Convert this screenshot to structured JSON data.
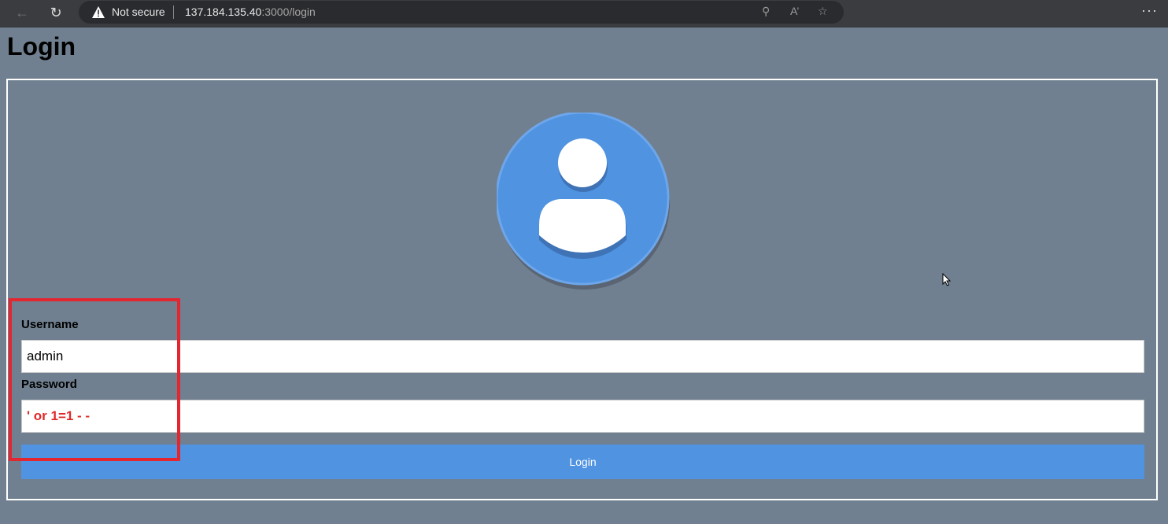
{
  "browser": {
    "security_label": "Not secure",
    "url_host": "137.184.135.40",
    "url_rest": ":3000/login",
    "menu_label": "···"
  },
  "page": {
    "title": "Login"
  },
  "form": {
    "username_label": "Username",
    "username_value": "admin",
    "password_label": "Password",
    "password_value": "' or 1=1 - -",
    "submit_label": "Login"
  },
  "colors": {
    "page_background": "#708090",
    "button": "#4f93e1",
    "avatar": "#4f93e1",
    "highlight": "#e3262f",
    "injected_text": "#e02828"
  },
  "icons": {
    "back": "arrow-left-icon",
    "reload": "reload-icon",
    "warning": "warning-triangle-icon",
    "key": "key-icon",
    "read_aloud": "read-aloud-icon",
    "favorites": "favorite-add-icon",
    "menu": "more-menu-icon",
    "avatar": "user-avatar-icon"
  }
}
